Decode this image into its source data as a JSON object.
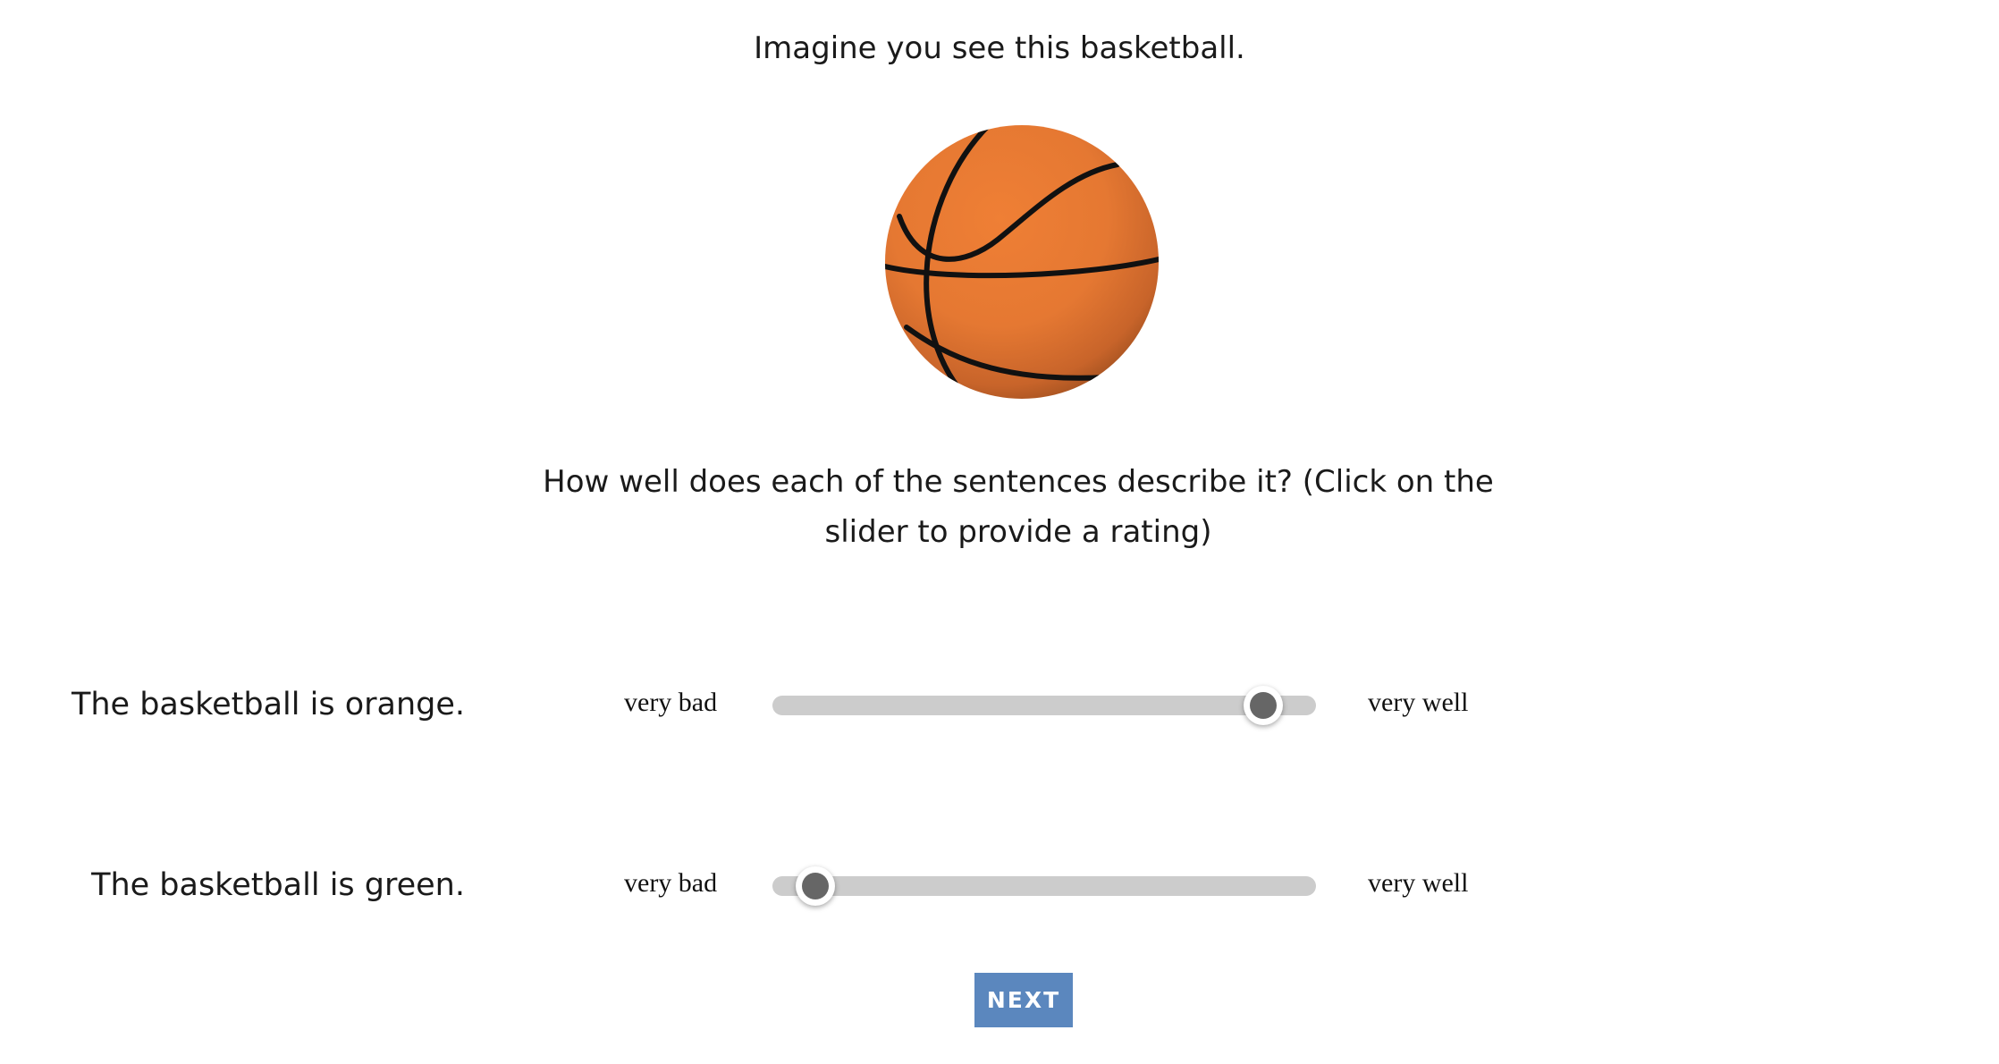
{
  "intro_text": "Imagine you see this basketball.",
  "image": {
    "icon": "basketball-icon",
    "alt": "basketball"
  },
  "question_text": "How well does each of the sentences describe it? (Click on the slider to provide a rating)",
  "ratings": [
    {
      "sentence": "The basketball is orange.",
      "low_label": "very bad",
      "high_label": "very well",
      "value": 0.94
    },
    {
      "sentence": "The basketball is green.",
      "low_label": "very bad",
      "high_label": "very well",
      "value": 0.04
    }
  ],
  "next_button": {
    "label": "NEXT"
  },
  "colors": {
    "ball_orange": "#e87a32",
    "ball_shadow": "#a4521f",
    "slider_track": "#cccccc",
    "slider_thumb": "#666666",
    "button": "#5b87be"
  }
}
